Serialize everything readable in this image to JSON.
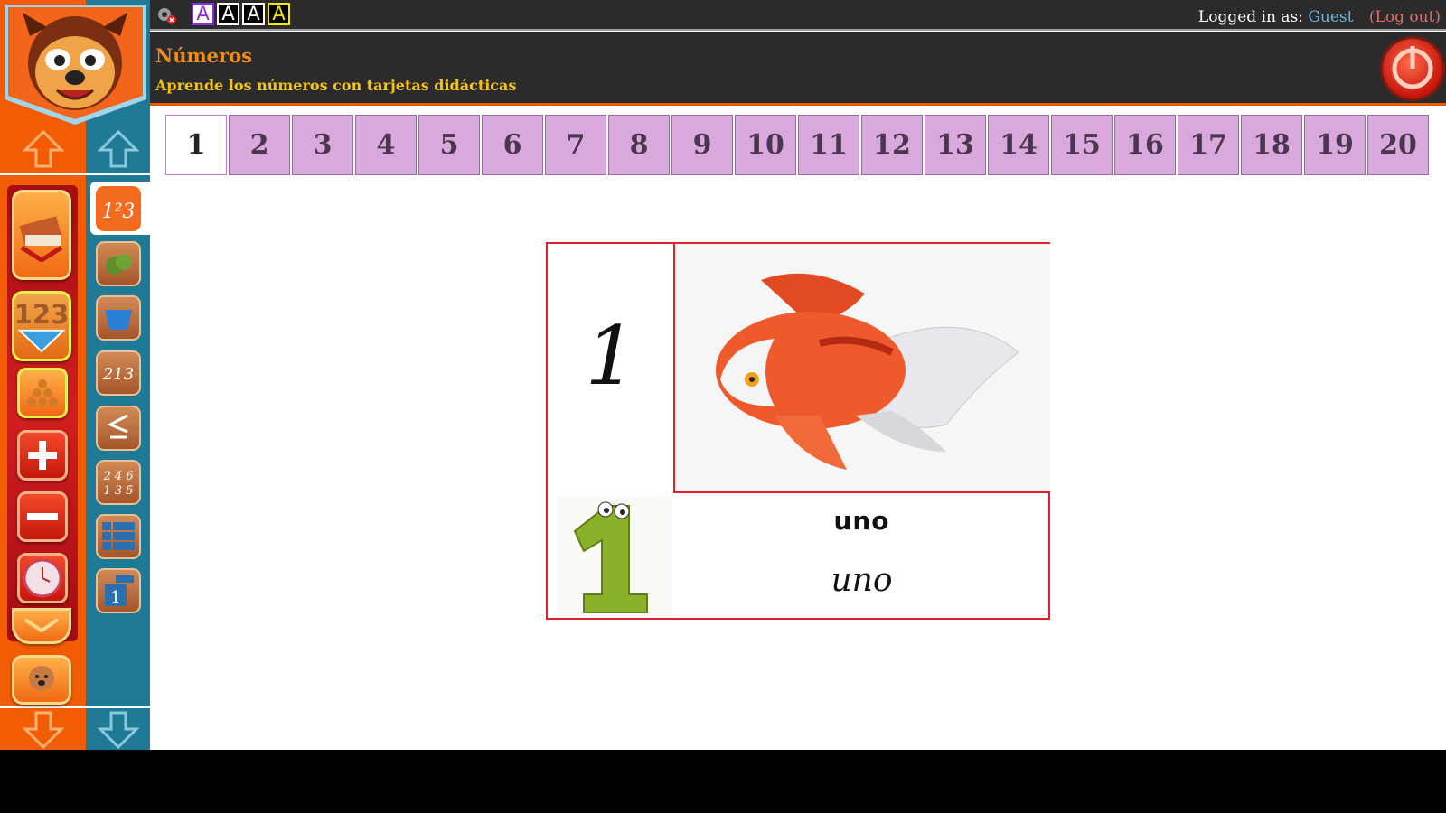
{
  "header": {
    "title": "Números",
    "subtitle": "Aprende los números con tarjetas didácticas"
  },
  "topbar": {
    "font_buttons": [
      "A",
      "A",
      "A",
      "A"
    ],
    "logged_in_label": "Logged in as:",
    "user": "Guest",
    "logout": "(Log out)"
  },
  "tabs": [
    "1",
    "2",
    "3",
    "4",
    "5",
    "6",
    "7",
    "8",
    "9",
    "10",
    "11",
    "12",
    "13",
    "14",
    "15",
    "16",
    "17",
    "18",
    "19",
    "20"
  ],
  "selected_tab": "1",
  "card": {
    "numeral": "1",
    "word_print": "uno",
    "word_cursive": "uno"
  },
  "left_nav": {
    "icons": [
      "books-icon",
      "numbers-ruler-icon",
      "counting-balls-icon",
      "plus-icon",
      "minus-icon",
      "clock-icon",
      "dog-icon"
    ]
  },
  "sub_nav": {
    "icons": [
      "123-icon",
      "apples-icon",
      "basket-icon",
      "213-order-icon",
      "less-equal-icon",
      "even-odd-icon",
      "number-table-icon",
      "number-card-icon"
    ]
  },
  "colors": {
    "orange": "#f25c05",
    "blue": "#1f7a95",
    "tab": "#d9a8dc",
    "card_border": "#e0202a",
    "title": "#f28c18",
    "subtitle": "#f5c316"
  }
}
